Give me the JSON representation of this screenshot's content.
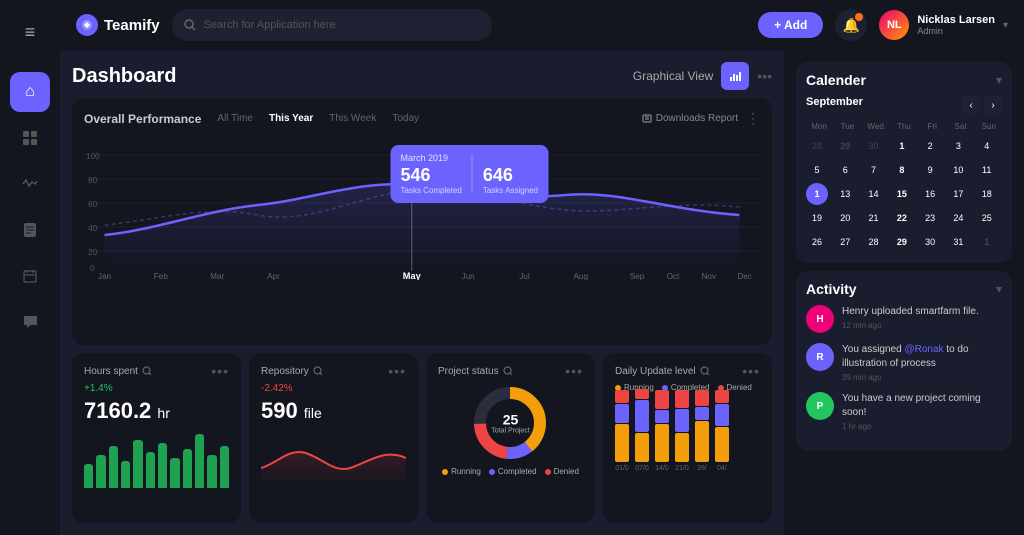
{
  "header": {
    "logo_text": "Teamify",
    "search_placeholder": "Search for Application here",
    "add_label": "+ Add",
    "notification_icon": "bell-icon",
    "user": {
      "name": "Nicklas Larsen",
      "role": "Admin",
      "avatar_initials": "NL"
    }
  },
  "sidebar": {
    "items": [
      {
        "id": "menu",
        "icon": "≡",
        "label": "Menu"
      },
      {
        "id": "home",
        "icon": "⌂",
        "label": "Home",
        "active": true
      },
      {
        "id": "analytics",
        "icon": "▦",
        "label": "Analytics"
      },
      {
        "id": "activity",
        "icon": "⚡",
        "label": "Activity"
      },
      {
        "id": "files",
        "icon": "▤",
        "label": "Files"
      },
      {
        "id": "calendar",
        "icon": "▦",
        "label": "Calendar"
      },
      {
        "id": "chat",
        "icon": "💬",
        "label": "Chat"
      }
    ]
  },
  "page": {
    "title": "Dashboard",
    "view_label": "Graphical View",
    "view_icon": "chart-icon"
  },
  "performance": {
    "title": "Overall Performance",
    "time_tabs": [
      "All Time",
      "This Year",
      "This Week",
      "Today"
    ],
    "active_tab": "This Year",
    "download_label": "Downloads Report",
    "tooltip": {
      "month": "March 2019",
      "tasks_completed_label": "Tasks Completed",
      "tasks_completed": "546",
      "tasks_assigned_label": "Tasks Assigned",
      "tasks_assigned": "646"
    },
    "y_axis": [
      "100",
      "80",
      "60",
      "40",
      "20",
      "0"
    ],
    "x_axis": [
      "Jan",
      "Feb",
      "Mar",
      "Apr",
      "May",
      "Jun",
      "Jul",
      "Aug",
      "Sep",
      "Oct",
      "Nov",
      "Dec"
    ]
  },
  "hours_spent": {
    "title": "Hours spent",
    "change": "+1.4%",
    "change_type": "positive",
    "value": "7160.2",
    "unit": "hr",
    "bars": [
      40,
      55,
      70,
      45,
      80,
      60,
      75,
      50,
      65,
      90,
      55,
      70
    ]
  },
  "repository": {
    "title": "Repository",
    "change": "-2.42%",
    "change_type": "negative",
    "value": "590",
    "unit": "file"
  },
  "project_status": {
    "title": "Project status",
    "total_label": "Total Project",
    "total": "25",
    "segments": [
      {
        "label": "Running",
        "pct": 65,
        "color": "#f59e0b"
      },
      {
        "label": "Completed",
        "pct": 12,
        "color": "#6c63ff"
      },
      {
        "label": "Denied",
        "pct": 23,
        "color": "#ef4444"
      }
    ],
    "legend": [
      "Running",
      "Completed",
      "Denied"
    ],
    "legend_colors": [
      "#f59e0b",
      "#6c63ff",
      "#ef4444"
    ]
  },
  "daily_update": {
    "title": "Daily Update level",
    "legend": [
      "Running",
      "Completed",
      "Denied"
    ],
    "legend_colors": [
      "#f59e0b",
      "#6c63ff",
      "#ef4444"
    ],
    "bars": [
      {
        "label": "01/0",
        "running": 60,
        "completed": 30,
        "denied": 20
      },
      {
        "label": "07/0",
        "running": 45,
        "completed": 50,
        "denied": 15
      },
      {
        "label": "14/0",
        "running": 70,
        "completed": 25,
        "denied": 35
      },
      {
        "label": "21/0",
        "running": 50,
        "completed": 40,
        "denied": 30
      },
      {
        "label": "28/",
        "running": 65,
        "completed": 20,
        "denied": 25
      },
      {
        "label": "04/",
        "running": 55,
        "completed": 35,
        "denied": 20
      }
    ]
  },
  "calendar": {
    "title": "Calender",
    "month": "September",
    "days_of_week": [
      "Mon",
      "Tue",
      "Wed",
      "Thu",
      "Fri",
      "Sat",
      "Sun"
    ],
    "weeks": [
      [
        "28",
        "29",
        "30",
        "1",
        "2",
        "3",
        "4"
      ],
      [
        "5",
        "6",
        "7",
        "8",
        "9",
        "10",
        "11"
      ],
      [
        "1",
        "13",
        "14",
        "15",
        "16",
        "17",
        "18"
      ],
      [
        "19",
        "20",
        "21",
        "22",
        "23",
        "24",
        "25"
      ],
      [
        "26",
        "27",
        "28",
        "29",
        "30",
        "31",
        "1"
      ]
    ],
    "today": "1",
    "today_index": "2-0",
    "muted_days": [
      "28",
      "29",
      "30",
      "1_last"
    ]
  },
  "activity": {
    "title": "Activity",
    "items": [
      {
        "avatar_color": "#e07",
        "avatar_initials": "H",
        "text": "Henry uploaded smartfarm file.",
        "time": "12 min ago"
      },
      {
        "avatar_color": "#6c63ff",
        "avatar_initials": "R",
        "text": "You assigned @Ronak to do illustration of process",
        "time": "39 min ago"
      },
      {
        "avatar_color": "#22c55e",
        "avatar_initials": "P",
        "text": "You have a new project coming soon!",
        "time": "1 hr ago"
      }
    ]
  }
}
